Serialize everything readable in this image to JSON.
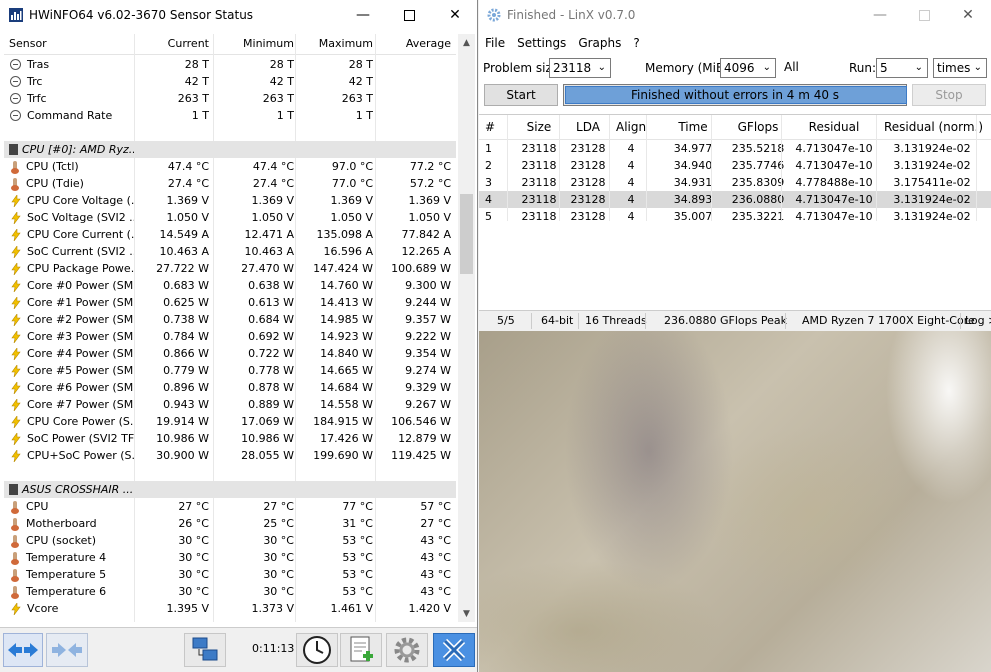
{
  "hwinfo": {
    "title": "HWiNFO64 v6.02-3670 Sensor Status",
    "columns": [
      "Sensor",
      "Current",
      "Minimum",
      "Maximum",
      "Average"
    ],
    "rows": [
      {
        "type": "clock",
        "name": "Tras",
        "cur": "28 T",
        "min": "28 T",
        "max": "28 T",
        "avg": ""
      },
      {
        "type": "clock",
        "name": "Trc",
        "cur": "42 T",
        "min": "42 T",
        "max": "42 T",
        "avg": ""
      },
      {
        "type": "clock",
        "name": "Trfc",
        "cur": "263 T",
        "min": "263 T",
        "max": "263 T",
        "avg": ""
      },
      {
        "type": "clock",
        "name": "Command Rate",
        "cur": "1 T",
        "min": "1 T",
        "max": "1 T",
        "avg": ""
      },
      {
        "type": "blank"
      },
      {
        "type": "group",
        "name": "CPU [#0]: AMD Ryz..."
      },
      {
        "type": "therm",
        "name": "CPU (Tctl)",
        "cur": "47.4 °C",
        "min": "47.4 °C",
        "max": "97.0 °C",
        "avg": "77.2 °C"
      },
      {
        "type": "therm",
        "name": "CPU (Tdie)",
        "cur": "27.4 °C",
        "min": "27.4 °C",
        "max": "77.0 °C",
        "avg": "57.2 °C"
      },
      {
        "type": "bolt",
        "name": "CPU Core Voltage (...",
        "cur": "1.369 V",
        "min": "1.369 V",
        "max": "1.369 V",
        "avg": "1.369 V"
      },
      {
        "type": "bolt",
        "name": "SoC Voltage (SVI2 ...",
        "cur": "1.050 V",
        "min": "1.050 V",
        "max": "1.050 V",
        "avg": "1.050 V"
      },
      {
        "type": "bolt",
        "name": "CPU Core Current (...",
        "cur": "14.549 A",
        "min": "12.471 A",
        "max": "135.098 A",
        "avg": "77.842 A"
      },
      {
        "type": "bolt",
        "name": "SoC Current (SVI2 ...",
        "cur": "10.463 A",
        "min": "10.463 A",
        "max": "16.596 A",
        "avg": "12.265 A"
      },
      {
        "type": "bolt",
        "name": "CPU Package Powe...",
        "cur": "27.722 W",
        "min": "27.470 W",
        "max": "147.424 W",
        "avg": "100.689 W"
      },
      {
        "type": "bolt",
        "name": "Core #0 Power (SMU)",
        "cur": "0.683 W",
        "min": "0.638 W",
        "max": "14.760 W",
        "avg": "9.300 W"
      },
      {
        "type": "bolt",
        "name": "Core #1 Power (SMU)",
        "cur": "0.625 W",
        "min": "0.613 W",
        "max": "14.413 W",
        "avg": "9.244 W"
      },
      {
        "type": "bolt",
        "name": "Core #2 Power (SMU)",
        "cur": "0.738 W",
        "min": "0.684 W",
        "max": "14.985 W",
        "avg": "9.357 W"
      },
      {
        "type": "bolt",
        "name": "Core #3 Power (SMU)",
        "cur": "0.784 W",
        "min": "0.692 W",
        "max": "14.923 W",
        "avg": "9.222 W"
      },
      {
        "type": "bolt",
        "name": "Core #4 Power (SMU)",
        "cur": "0.866 W",
        "min": "0.722 W",
        "max": "14.840 W",
        "avg": "9.354 W"
      },
      {
        "type": "bolt",
        "name": "Core #5 Power (SMU)",
        "cur": "0.779 W",
        "min": "0.778 W",
        "max": "14.665 W",
        "avg": "9.274 W"
      },
      {
        "type": "bolt",
        "name": "Core #6 Power (SMU)",
        "cur": "0.896 W",
        "min": "0.878 W",
        "max": "14.684 W",
        "avg": "9.329 W"
      },
      {
        "type": "bolt",
        "name": "Core #7 Power (SMU)",
        "cur": "0.943 W",
        "min": "0.889 W",
        "max": "14.558 W",
        "avg": "9.267 W"
      },
      {
        "type": "bolt",
        "name": "CPU Core Power (S...",
        "cur": "19.914 W",
        "min": "17.069 W",
        "max": "184.915 W",
        "avg": "106.546 W"
      },
      {
        "type": "bolt",
        "name": "SoC Power (SVI2 TFN)",
        "cur": "10.986 W",
        "min": "10.986 W",
        "max": "17.426 W",
        "avg": "12.879 W"
      },
      {
        "type": "bolt",
        "name": "CPU+SoC Power (S...",
        "cur": "30.900 W",
        "min": "28.055 W",
        "max": "199.690 W",
        "avg": "119.425 W"
      },
      {
        "type": "blank"
      },
      {
        "type": "group",
        "name": "ASUS CROSSHAIR ..."
      },
      {
        "type": "therm",
        "name": "CPU",
        "cur": "27 °C",
        "min": "27 °C",
        "max": "77 °C",
        "avg": "57 °C"
      },
      {
        "type": "therm",
        "name": "Motherboard",
        "cur": "26 °C",
        "min": "25 °C",
        "max": "31 °C",
        "avg": "27 °C"
      },
      {
        "type": "therm",
        "name": "CPU (socket)",
        "cur": "30 °C",
        "min": "30 °C",
        "max": "53 °C",
        "avg": "43 °C"
      },
      {
        "type": "therm",
        "name": "Temperature 4",
        "cur": "30 °C",
        "min": "30 °C",
        "max": "53 °C",
        "avg": "43 °C"
      },
      {
        "type": "therm",
        "name": "Temperature 5",
        "cur": "30 °C",
        "min": "30 °C",
        "max": "53 °C",
        "avg": "43 °C"
      },
      {
        "type": "therm",
        "name": "Temperature 6",
        "cur": "30 °C",
        "min": "30 °C",
        "max": "53 °C",
        "avg": "43 °C"
      },
      {
        "type": "bolt",
        "name": "Vcore",
        "cur": "1.395 V",
        "min": "1.373 V",
        "max": "1.461 V",
        "avg": "1.420 V"
      }
    ],
    "elapsed": "0:11:13"
  },
  "linx": {
    "title": "Finished - LinX v0.7.0",
    "menu": [
      "File",
      "Settings",
      "Graphs",
      "?"
    ],
    "problem_size_label": "Problem size:",
    "problem_size": "23118",
    "memory_label": "Memory (MiB):",
    "memory": "4096",
    "all_label": "All",
    "run_label": "Run:",
    "run": "5",
    "run_unit": "times",
    "start_label": "Start",
    "stop_label": "Stop",
    "progress_text": "Finished without errors in 4 m 40 s",
    "progress": 1.0,
    "columns": [
      "#",
      "Size",
      "LDA",
      "Align",
      "Time",
      "GFlops",
      "Residual",
      "Residual (norm.)"
    ],
    "results": [
      [
        "1",
        "23118",
        "23128",
        "4",
        "34.977",
        "235.5218",
        "4.713047e-10",
        "3.131924e-02"
      ],
      [
        "2",
        "23118",
        "23128",
        "4",
        "34.940",
        "235.7746",
        "4.713047e-10",
        "3.131924e-02"
      ],
      [
        "3",
        "23118",
        "23128",
        "4",
        "34.931",
        "235.8309",
        "4.778488e-10",
        "3.175411e-02"
      ],
      [
        "4",
        "23118",
        "23128",
        "4",
        "34.893",
        "236.0880",
        "4.713047e-10",
        "3.131924e-02"
      ],
      [
        "5",
        "23118",
        "23128",
        "4",
        "35.007",
        "235.3221",
        "4.713047e-10",
        "3.131924e-02"
      ]
    ],
    "selected_row": 3,
    "status": {
      "runs": "5/5",
      "bits": "64-bit",
      "threads": "16 Threads",
      "peak": "236.0880 GFlops Peak",
      "cpu": "AMD Ryzen 7 1700X Eight-Core",
      "log": "Log >"
    }
  }
}
